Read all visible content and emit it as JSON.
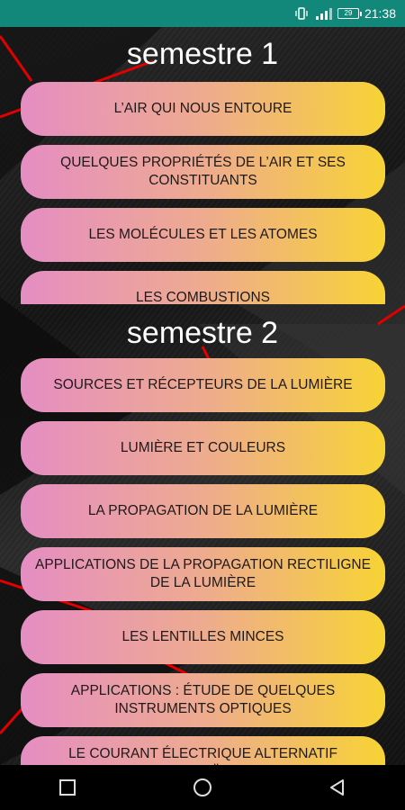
{
  "status_bar": {
    "time": "21:38",
    "battery": "29",
    "network": "4G",
    "icons": [
      "vibrate-icon",
      "signal-icon",
      "battery-icon"
    ]
  },
  "semester1": {
    "title": "semestre 1",
    "chapters": [
      {
        "label": "L’AIR QUI NOUS ENTOURE"
      },
      {
        "label": "QUELQUES PROPRIÉTÉS DE L’AIR ET SES CONSTITUANTS"
      },
      {
        "label": "LES MOLÉCULES ET LES ATOMES"
      },
      {
        "label": "LES COMBUSTIONS"
      }
    ]
  },
  "semester2": {
    "title": "semestre 2",
    "chapters": [
      {
        "label": "SOURCES ET RÉCEPTEURS DE LA LUMIÈRE"
      },
      {
        "label": "LUMIÈRE ET COULEURS"
      },
      {
        "label": "LA PROPAGATION DE LA LUMIÈRE"
      },
      {
        "label": "APPLICATIONS DE LA PROPAGATION RECTILIGNE DE LA LUMIÈRE"
      },
      {
        "label": "LES LENTILLES MINCES"
      },
      {
        "label": "APPLICATIONS : ÉTUDE DE QUELQUES INSTRUMENTS OPTIQUES"
      },
      {
        "label": "LE COURANT ÉLECTRIQUE ALTERNATIF SINUSOÏDAL"
      }
    ]
  },
  "colors": {
    "status_bar": "#11887a",
    "button_gradient_start": "#e58dc3",
    "button_gradient_end": "#f7d335",
    "accent_lines": "#e00000"
  },
  "nav_bar": {
    "icons": [
      "recents-square-icon",
      "home-circle-icon",
      "back-triangle-icon"
    ]
  }
}
